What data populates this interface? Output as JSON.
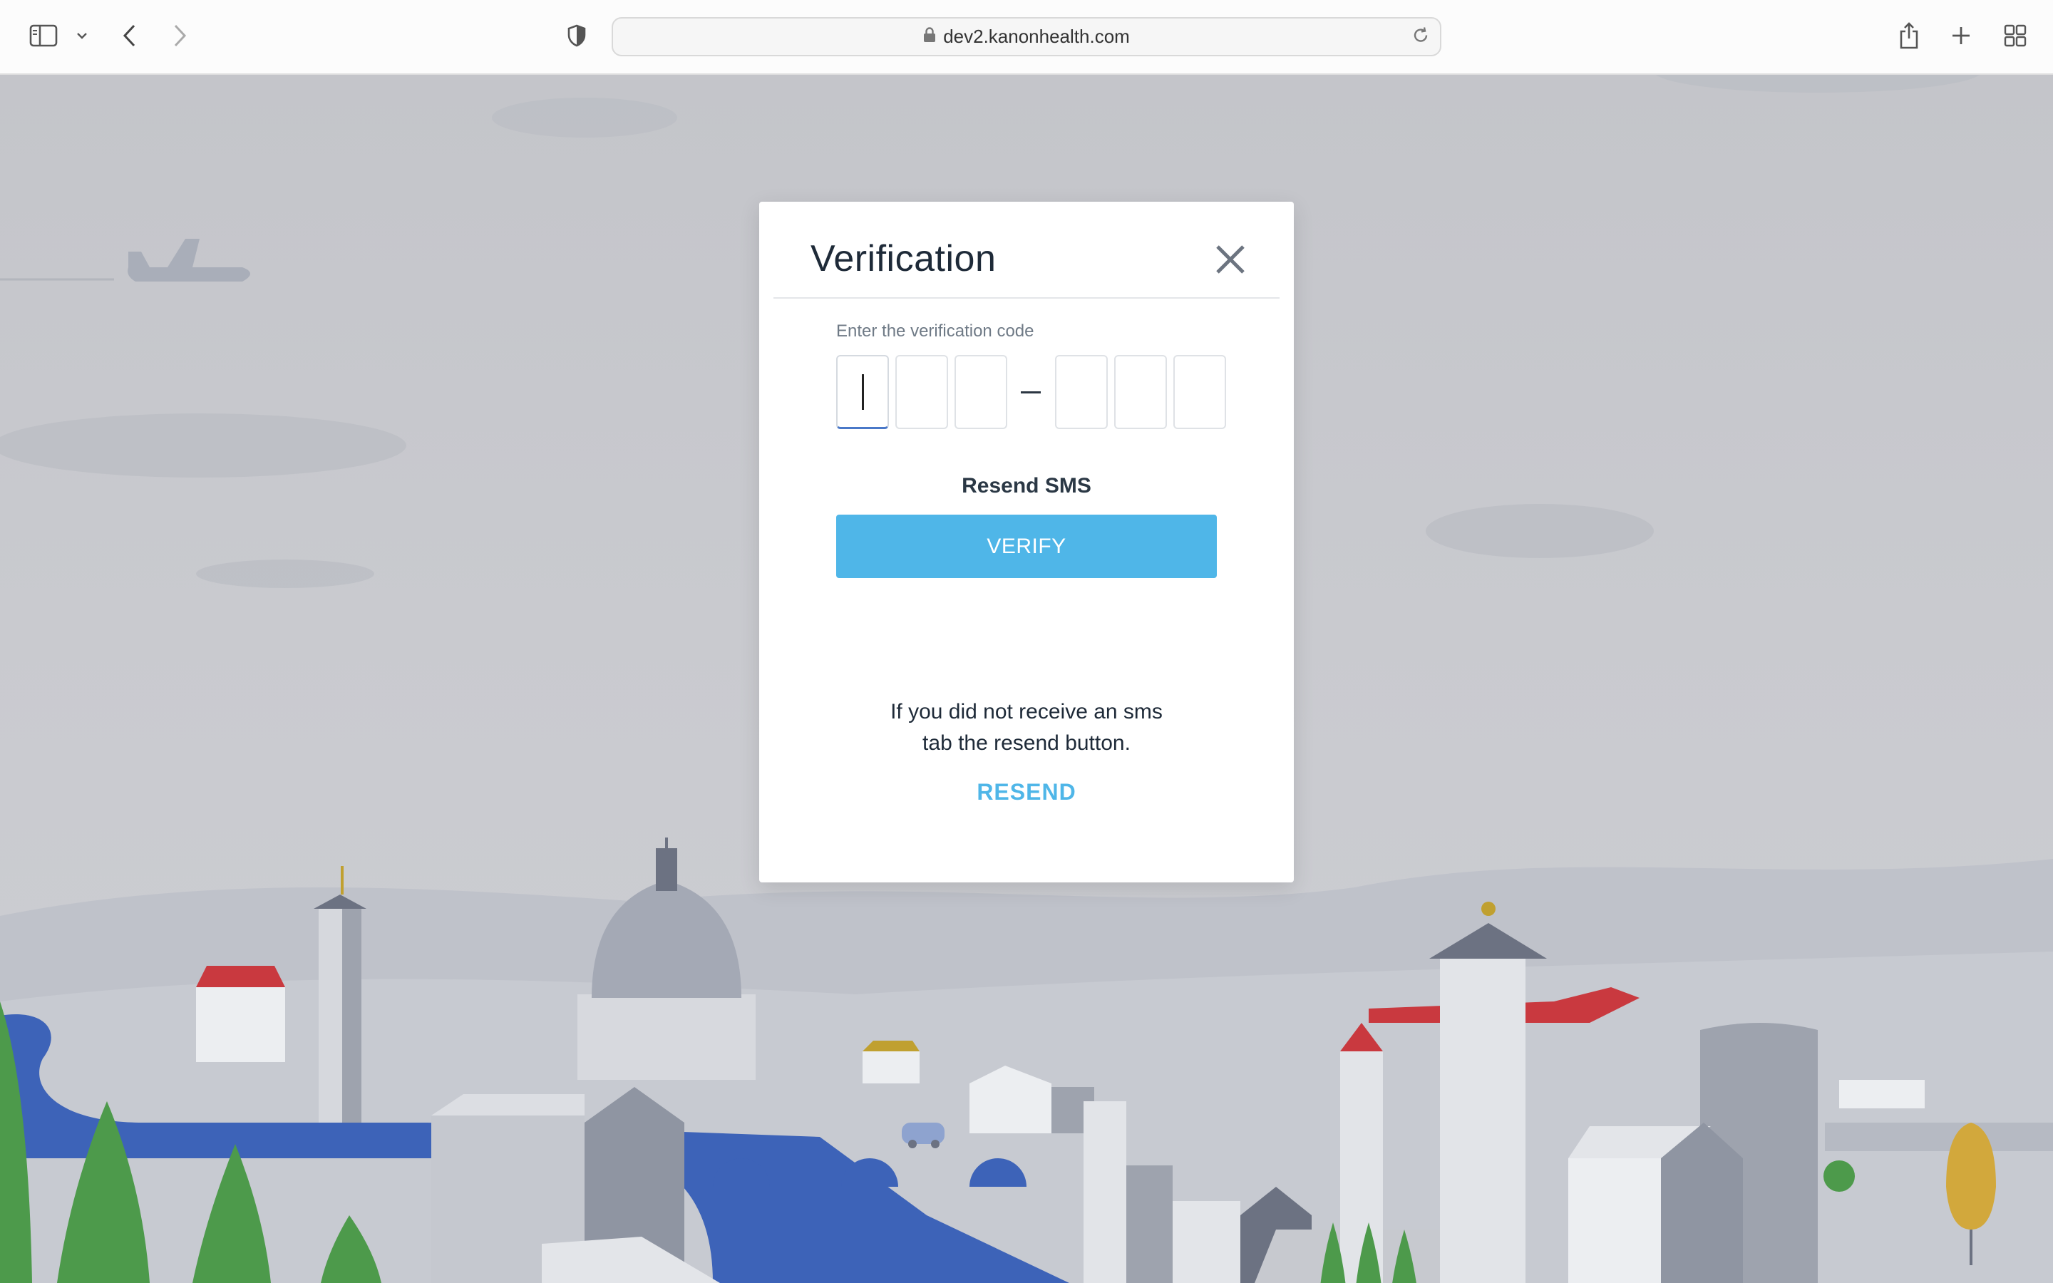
{
  "browser": {
    "url": "dev2.kanonhealth.com",
    "icons": [
      "sidebar-icon",
      "chevron-down-icon",
      "back-arrow-icon",
      "forward-arrow-icon",
      "privacy-shield-icon",
      "lock-icon",
      "reload-icon",
      "share-icon",
      "plus-icon",
      "tab-overview-icon"
    ]
  },
  "modal": {
    "title": "Verification",
    "code_label": "Enter the verification code",
    "code_digits": [
      "",
      "",
      "",
      "",
      "",
      ""
    ],
    "resend_sms_label": "Resend SMS",
    "verify_label": "VERIFY",
    "info_line1": "If you did not receive an sms",
    "info_line2": "tab the resend button.",
    "resend_label": "RESEND"
  },
  "colors": {
    "accent": "#4fb6e8",
    "title_text": "#1e2a38",
    "background": "#c9cacf"
  }
}
